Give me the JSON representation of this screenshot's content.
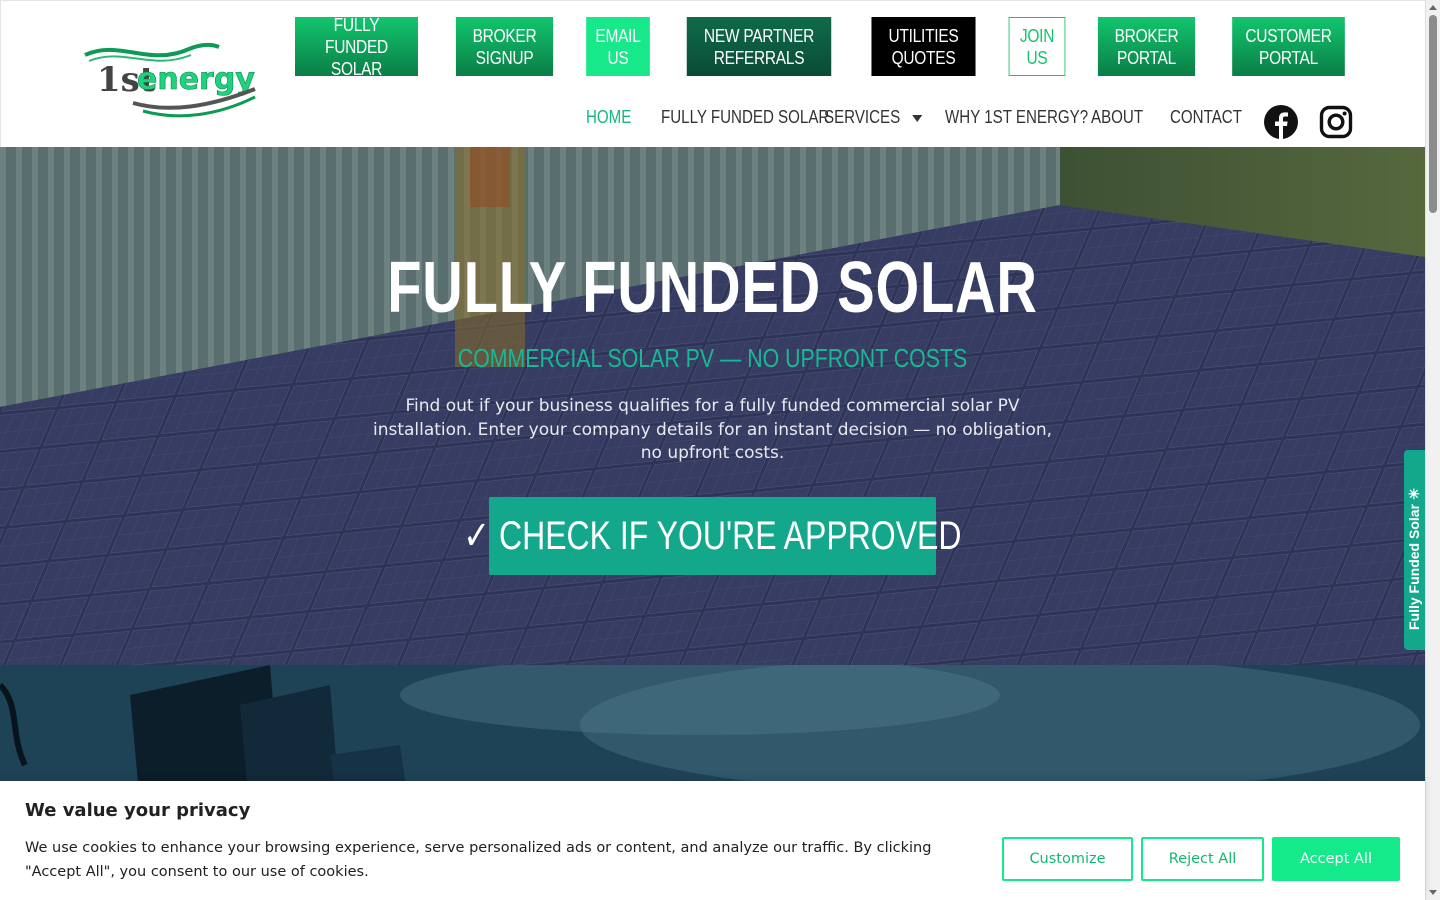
{
  "brand": {
    "logo_prefix": "1st",
    "logo_word": "energy"
  },
  "top_buttons": [
    {
      "label": "FULLY FUNDED\nSOLAR"
    },
    {
      "label": "BROKER\nSIGNUP"
    },
    {
      "label": "EMAIL\nUS"
    },
    {
      "label": "NEW PARTNER\nREFERRALS"
    },
    {
      "label": "UTILITIES\nQUOTES"
    },
    {
      "label": "JOIN\nUS"
    },
    {
      "label": "BROKER\nPORTAL"
    },
    {
      "label": "CUSTOMER\nPORTAL"
    }
  ],
  "nav": {
    "items": [
      {
        "label": "HOME",
        "active": true
      },
      {
        "label": "FULLY FUNDED SOLAR"
      },
      {
        "label": "SERVICES"
      },
      {
        "label": "WHY 1ST ENERGY?"
      },
      {
        "label": "ABOUT"
      },
      {
        "label": "CONTACT"
      }
    ],
    "social": [
      "facebook-icon",
      "instagram-icon"
    ]
  },
  "hero": {
    "title": "FULLY FUNDED SOLAR",
    "subtitle": "COMMERCIAL SOLAR PV — NO UPFRONT COSTS",
    "description": "Find out if your business qualifies for a fully funded commercial solar PV installation. Enter your company details for an instant decision — no obligation, no upfront costs.",
    "cta_label": "✓ CHECK IF YOU'RE APPROVED",
    "side_tab_label": "Fully Funded Solar ☀"
  },
  "cookie_banner": {
    "title": "We value your privacy",
    "text": "We use cookies to enhance your browsing experience, serve personalized ads or content, and analyze our traffic. By clicking \"Accept All\", you consent to our use of cookies.",
    "customize_label": "Customize",
    "reject_label": "Reject All",
    "accept_label": "Accept All"
  },
  "colors": {
    "brand_green": "#12c56d",
    "accent_teal": "#13a88c",
    "cookie_green": "#15ea8a"
  }
}
